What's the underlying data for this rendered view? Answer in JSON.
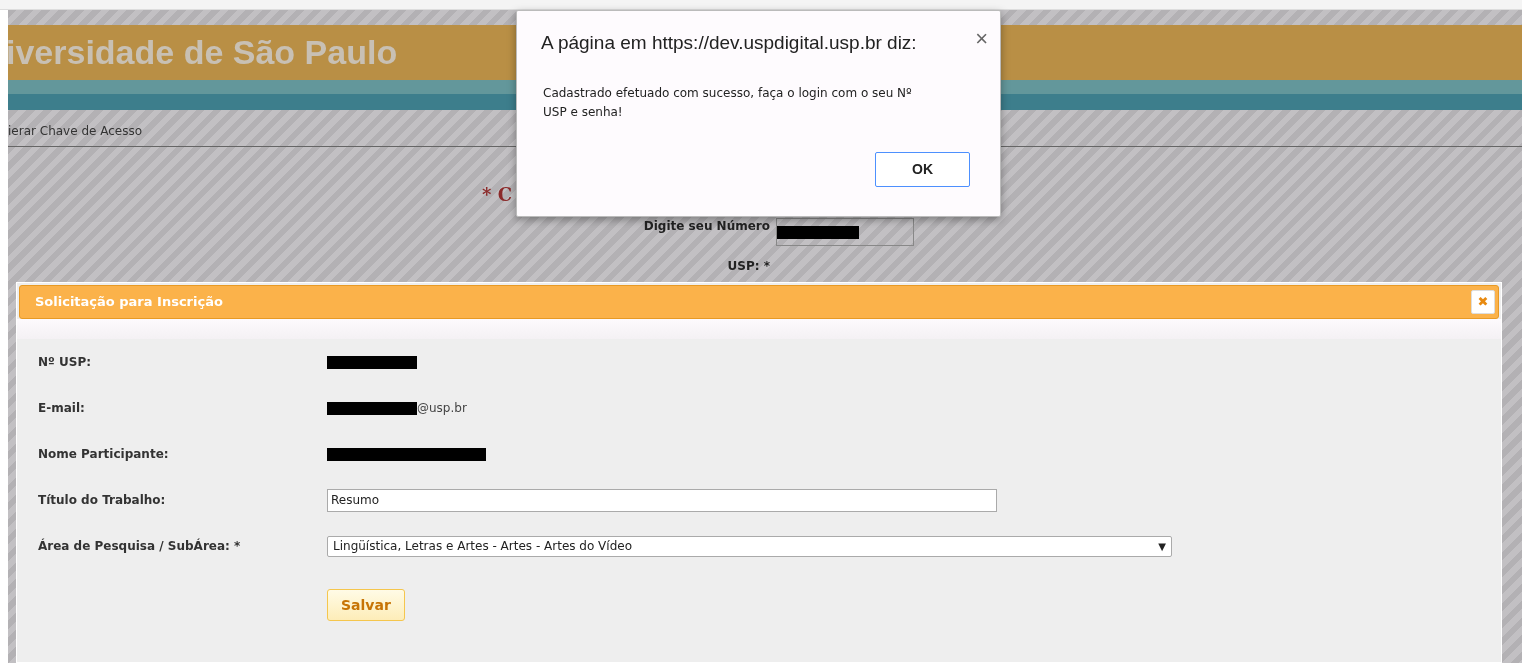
{
  "page": {
    "banner_title": "iversidade de São Paulo",
    "nav_link": "ierar Chave de Acesso",
    "heading": "* C",
    "usp_label": "Digite seu Número USP: *"
  },
  "modal": {
    "title": "Solicitação para Inscrição",
    "close": "✖",
    "fields": [
      {
        "label": "Nº USP:",
        "kind": "redacted"
      },
      {
        "label": "E-mail:",
        "kind": "email",
        "suffix": "@usp.br"
      },
      {
        "label": "Nome Participante:",
        "kind": "redacted_long"
      },
      {
        "label": "Título do Trabalho:",
        "kind": "text_input",
        "value": "Resumo"
      },
      {
        "label": "Área de Pesquisa / SubÁrea: *",
        "kind": "select",
        "value": "Lingüística, Letras e Artes - Artes - Artes do Vídeo",
        "caret": "▼"
      }
    ],
    "button": "Salvar"
  },
  "alert": {
    "title": "A página em https://dev.uspdigital.usp.br diz:",
    "close": "×",
    "message": "Cadastrado efetuado com sucesso, faça o login com o seu Nº USP e senha!",
    "ok": "OK"
  }
}
